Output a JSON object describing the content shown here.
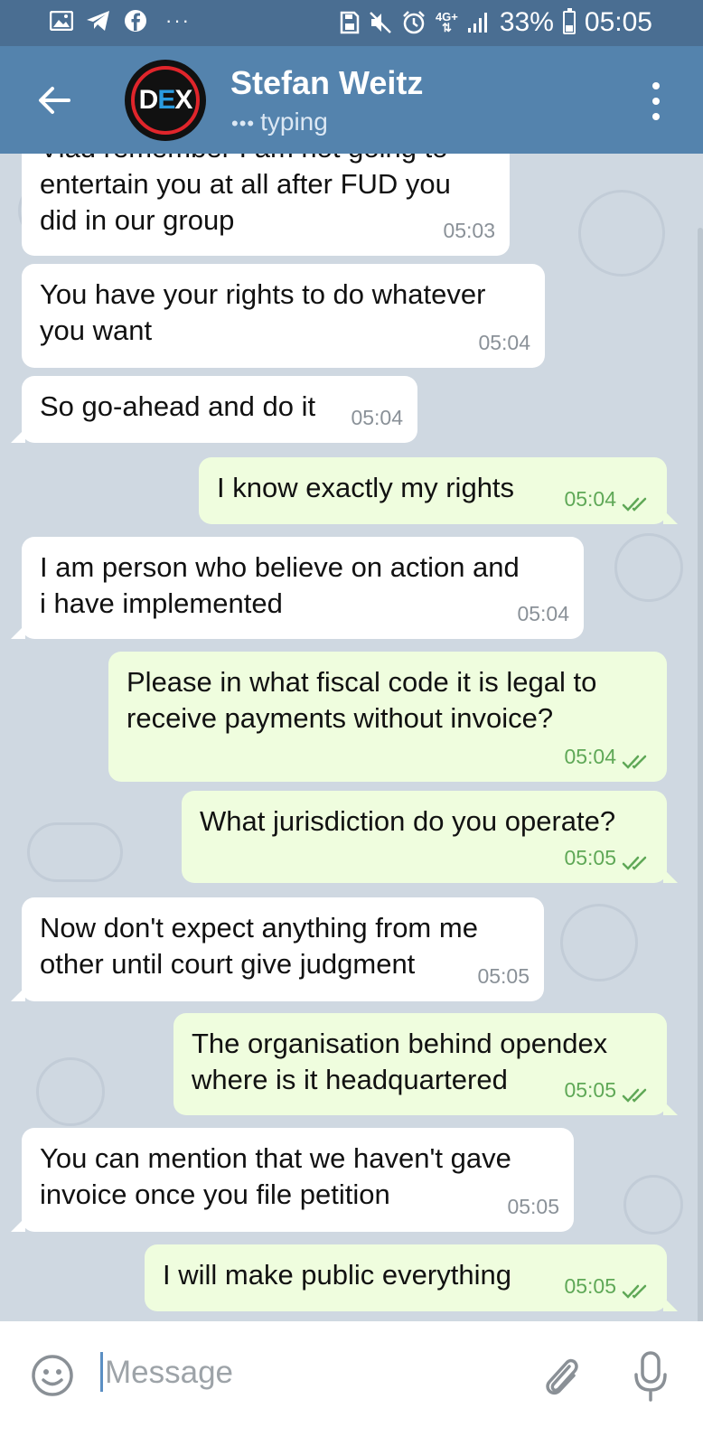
{
  "status_bar": {
    "left_icons": [
      "gallery-icon",
      "telegram-icon",
      "facebook-icon"
    ],
    "more": "···",
    "right_icons": [
      "save-icon",
      "mute-icon",
      "alarm-icon"
    ],
    "network": "4G+",
    "battery": "33%",
    "battery_level": 0.33,
    "time": "05:05"
  },
  "header": {
    "contact_name": "Stefan Weitz",
    "status": "typing",
    "status_dots": "•••",
    "avatar_logo": [
      "D",
      "E",
      "X"
    ]
  },
  "messages": [
    {
      "dir": "in",
      "text": "Vlad remember I am not going to\nentertain you at all after FUD you\ndid in our group",
      "time": "05:03",
      "read": false
    },
    {
      "dir": "in",
      "text": "You have your rights to do whatever\nyou want",
      "time": "05:04",
      "read": false
    },
    {
      "dir": "in",
      "text": "So go-ahead and do it",
      "time": "05:04",
      "read": false
    },
    {
      "dir": "out",
      "text": "I know exactly my rights",
      "time": "05:04",
      "read": true
    },
    {
      "dir": "in",
      "text": "I am person who believe on action and\ni have implemented",
      "time": "05:04",
      "read": false
    },
    {
      "dir": "out",
      "text": "Please in what fiscal code it is legal to\nreceive payments without invoice?",
      "time": "05:04",
      "read": true
    },
    {
      "dir": "out",
      "text": "What jurisdiction do you operate?",
      "time": "05:05",
      "read": true
    },
    {
      "dir": "in",
      "text": "Now don't expect anything from me\nother until court give judgment",
      "time": "05:05",
      "read": false
    },
    {
      "dir": "out",
      "text": "The organisation behind opendex\nwhere is it headquartered",
      "time": "05:05",
      "read": true
    },
    {
      "dir": "in",
      "text": "You can mention that we haven't gave\ninvoice once you file petition",
      "time": "05:05",
      "read": false
    },
    {
      "dir": "out",
      "text": "I will make public everything",
      "time": "05:05",
      "read": true
    }
  ],
  "input": {
    "placeholder": "Message",
    "value": ""
  },
  "colors": {
    "status_bar": "#4a6e92",
    "header": "#5483ad",
    "chat_bg": "#cfd8e1",
    "bubble_in": "#ffffff",
    "bubble_out": "#effdde",
    "check": "#5fa857"
  }
}
